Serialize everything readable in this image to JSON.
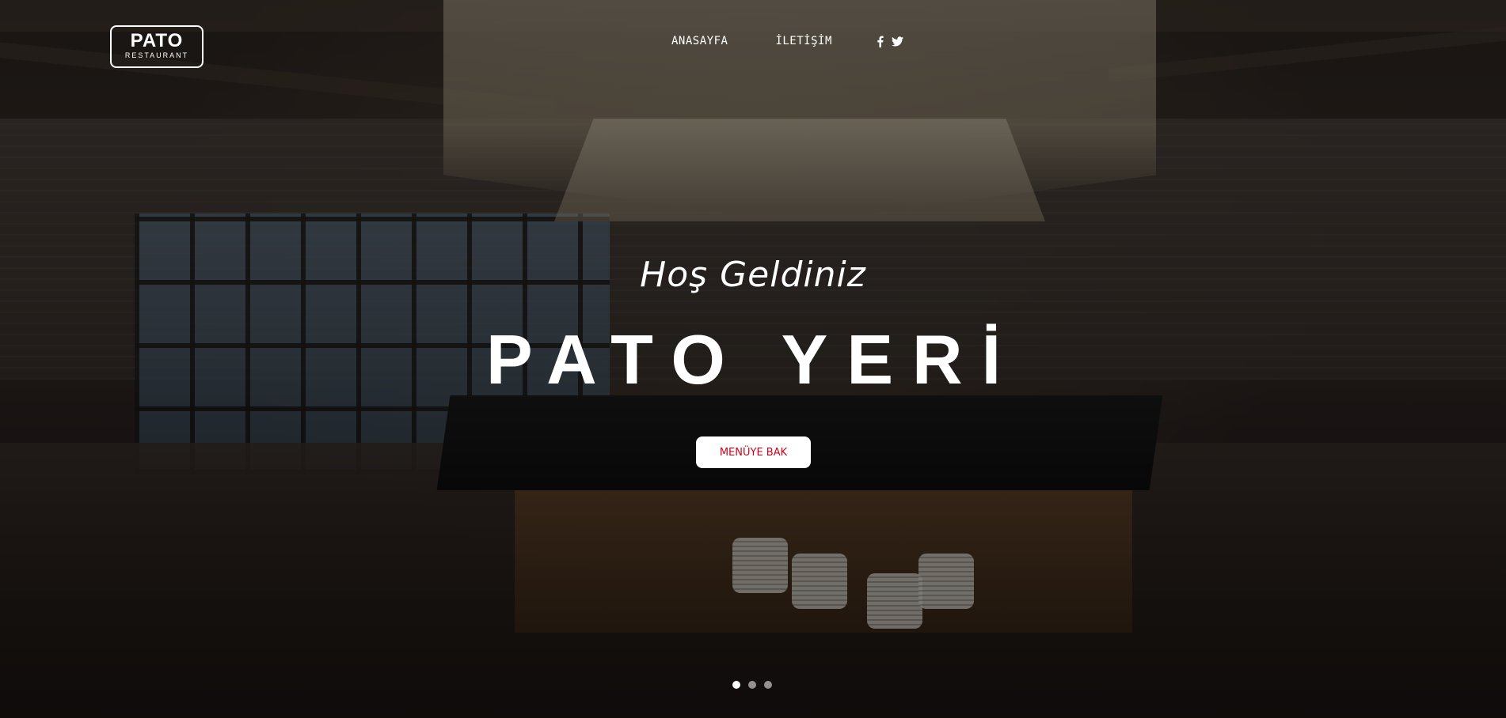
{
  "logo": {
    "main": "PATO",
    "sub": "RESTAURANT"
  },
  "nav": {
    "items": [
      {
        "label": "ANASAYFA"
      },
      {
        "label": "İLETİŞİM"
      }
    ]
  },
  "social": [
    {
      "icon": "facebook-icon"
    },
    {
      "icon": "twitter-icon"
    }
  ],
  "hero": {
    "welcome": "Hoş Geldiniz",
    "title": "PATO YERİ",
    "cta_label": "MENÜYE BAK",
    "slides": {
      "count": 3,
      "active": 1
    }
  },
  "colors": {
    "cta_text": "#d0021b",
    "text": "#ffffff"
  }
}
